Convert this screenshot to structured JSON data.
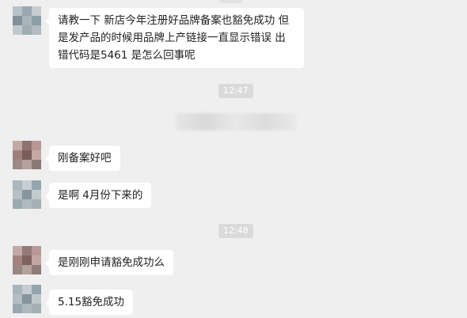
{
  "chat": {
    "messages": [
      {
        "text_lines": [
          "请教一下 新店今年注册好品牌备案也豁免成功 但",
          "是发产品的时候用品牌上产链接一直显示错误  出",
          "错代码是5461 是怎么回事呢"
        ]
      },
      {
        "text": "刚备案好吧"
      },
      {
        "text": "是啊 4月份下来的"
      },
      {
        "text": "是刚刚申请豁免成功么"
      },
      {
        "text": "5.15豁免成功"
      }
    ],
    "timestamps": [
      "12:47",
      "12:48"
    ]
  },
  "colors": {
    "background": "#efefef",
    "bubble": "#ffffff",
    "timestamp_bg": "#dadada",
    "text": "#222222"
  },
  "icons": {
    "avatar": "pixelated-avatar",
    "redaction": "blurred-redaction"
  }
}
